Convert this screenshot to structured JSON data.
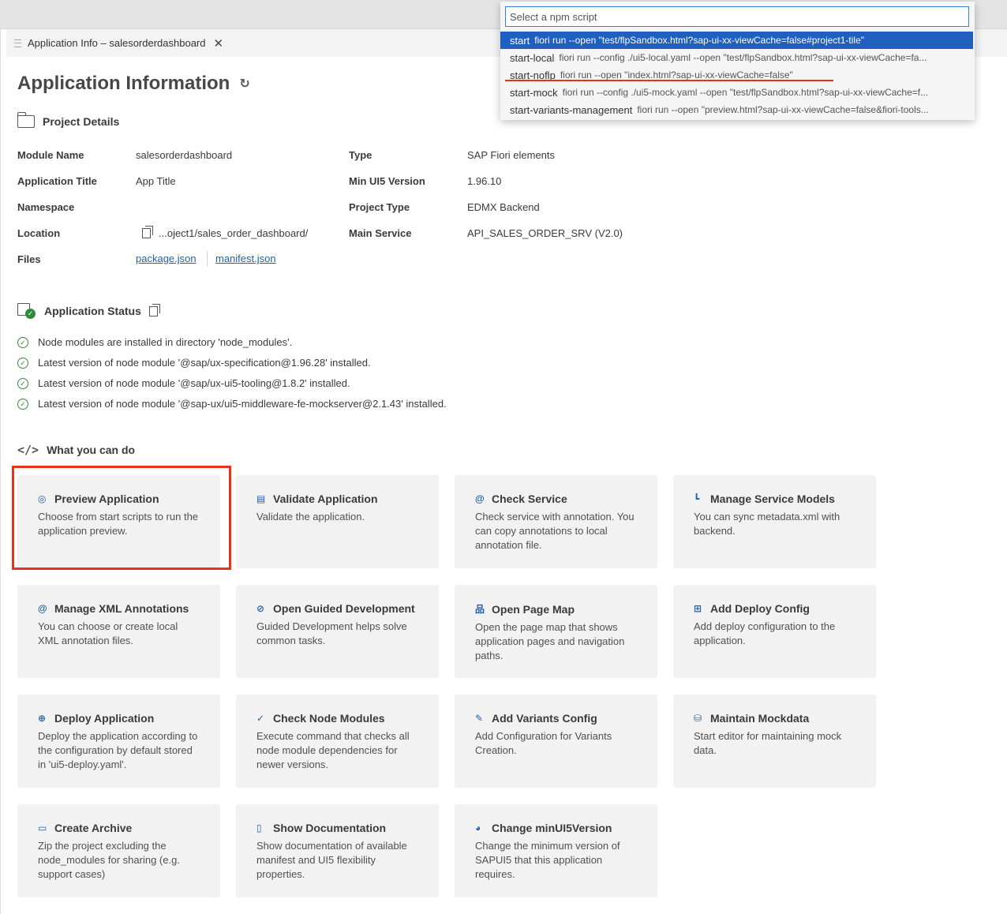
{
  "tab": {
    "label": "Application Info – salesorderdashboard",
    "close": "✕"
  },
  "page": {
    "title": "Application Information",
    "refresh_icon": "refresh-icon"
  },
  "project_details": {
    "heading": "Project Details",
    "left": [
      {
        "label": "Module Name",
        "value": "salesorderdashboard"
      },
      {
        "label": "Application Title",
        "value": "App Title"
      },
      {
        "label": "Namespace",
        "value": ""
      },
      {
        "label": "Location",
        "value": "...oject1/sales_order_dashboard/"
      },
      {
        "label": "Files",
        "value": ""
      }
    ],
    "right": [
      {
        "label": "Type",
        "value": "SAP Fiori elements"
      },
      {
        "label": "Min UI5 Version",
        "value": "1.96.10"
      },
      {
        "label": "Project Type",
        "value": "EDMX Backend"
      },
      {
        "label": "Main Service",
        "value": "API_SALES_ORDER_SRV (V2.0)"
      }
    ],
    "files": [
      "package.json",
      "manifest.json"
    ]
  },
  "application_status": {
    "heading": "Application Status",
    "items": [
      "Node modules are installed in directory 'node_modules'.",
      "Latest version of node module '@sap/ux-specification@1.96.28' installed.",
      "Latest version of node module '@sap/ux-ui5-tooling@1.8.2' installed.",
      "Latest version of node module '@sap-ux/ui5-middleware-fe-mockserver@2.1.43' installed."
    ]
  },
  "what_you_can_do": {
    "heading": "What you can do",
    "cards": [
      {
        "title": "Preview Application",
        "desc": "Choose from start scripts to run the application preview.",
        "icon": "preview-icon",
        "glyph": "◎"
      },
      {
        "title": "Validate Application",
        "desc": "Validate the application.",
        "icon": "validate-icon",
        "glyph": "▤"
      },
      {
        "title": "Check Service",
        "desc": "Check service with annotation. You can copy annotations to local annotation file.",
        "icon": "at-icon",
        "glyph": "@"
      },
      {
        "title": "Manage Service Models",
        "desc": "You can sync metadata.xml with backend.",
        "icon": "service-model-icon",
        "glyph": "┗"
      },
      {
        "title": "Manage XML Annotations",
        "desc": "You can choose or create local XML annotation files.",
        "icon": "at-icon",
        "glyph": "@"
      },
      {
        "title": "Open Guided Development",
        "desc": "Guided Development helps solve common tasks.",
        "icon": "guided-development-icon",
        "glyph": "⊘"
      },
      {
        "title": "Open Page Map",
        "desc": "Open the page map that shows application pages and navigation paths.",
        "icon": "page-map-icon",
        "glyph": "品"
      },
      {
        "title": "Add Deploy Config",
        "desc": "Add deploy configuration to the application.",
        "icon": "add-config-icon",
        "glyph": "⊞"
      },
      {
        "title": "Deploy Application",
        "desc": "Deploy the application according to the configuration by default stored in 'ui5-deploy.yaml'.",
        "icon": "globe-icon",
        "glyph": "⊕"
      },
      {
        "title": "Check Node Modules",
        "desc": "Execute command that checks all node module dependencies for newer versions.",
        "icon": "broom-icon",
        "glyph": "✓"
      },
      {
        "title": "Add Variants Config",
        "desc": "Add Configuration for Variants Creation.",
        "icon": "pencil-icon",
        "glyph": "✎"
      },
      {
        "title": "Maintain Mockdata",
        "desc": "Start editor for maintaining mock data.",
        "icon": "database-icon",
        "glyph": "⛁"
      },
      {
        "title": "Create Archive",
        "desc": "Zip the project excluding the node_modules for sharing (e.g. support cases)",
        "icon": "folder-open-icon",
        "glyph": "▭"
      },
      {
        "title": "Show Documentation",
        "desc": "Show documentation of available manifest and UI5 flexibility properties.",
        "icon": "document-icon",
        "glyph": "▯"
      },
      {
        "title": "Change minUI5Version",
        "desc": "Change the minimum version of SAPUI5 that this application requires.",
        "icon": "ui5-icon",
        "glyph": "◕"
      }
    ]
  },
  "quickpick": {
    "placeholder": "Select a npm script",
    "items": [
      {
        "name": "start",
        "cmd": "fiori run --open \"test/flpSandbox.html?sap-ui-xx-viewCache=false#project1-tile\"",
        "selected": true
      },
      {
        "name": "start-local",
        "cmd": "fiori run --config ./ui5-local.yaml --open \"test/flpSandbox.html?sap-ui-xx-viewCache=fa...",
        "selected": false
      },
      {
        "name": "start-noflp",
        "cmd": "fiori run --open \"index.html?sap-ui-xx-viewCache=false\"",
        "selected": false
      },
      {
        "name": "start-mock",
        "cmd": "fiori run --config ./ui5-mock.yaml --open \"test/flpSandbox.html?sap-ui-xx-viewCache=f...",
        "selected": false
      },
      {
        "name": "start-variants-management",
        "cmd": "fiori run --open \"preview.html?sap-ui-xx-viewCache=false&fiori-tools...",
        "selected": false
      }
    ]
  },
  "colors": {
    "selected": "#1f5fbf",
    "highlight": "#e53219",
    "link": "#2461a8",
    "status_ok": "#2e8b3a"
  }
}
